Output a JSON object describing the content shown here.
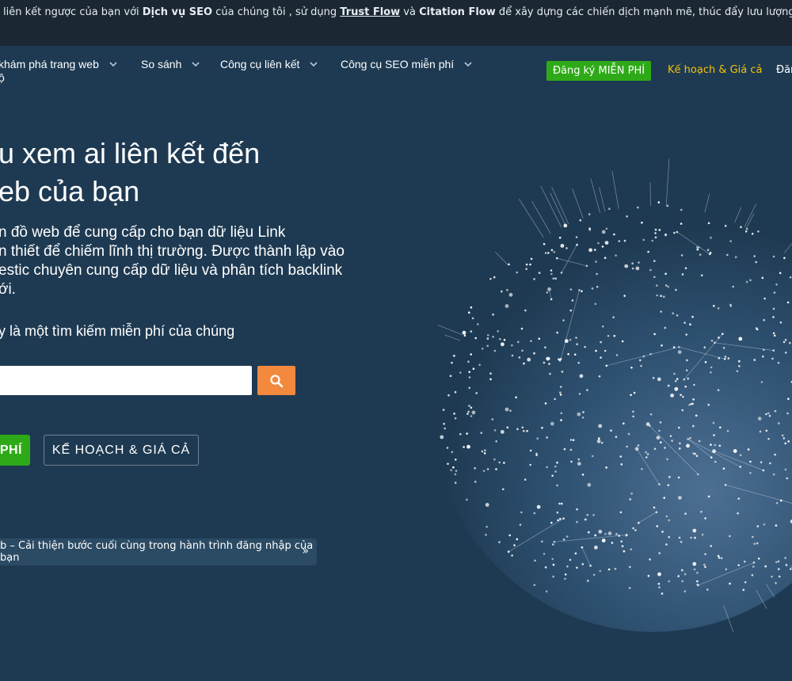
{
  "topbar": {
    "p1": " liên kết ngược của bạn với ",
    "b1": "Dịch vụ SEO",
    "p2": " của chúng tôi , sử dụng ",
    "tf": "Trust Flow",
    "p3": " và ",
    "b2": "Citation Flow",
    "p4": " để xây dựng các chiến dịch mạnh mẽ, thúc đẩy lưu lượng tru"
  },
  "nav": {
    "items": [
      {
        "label": "khám phá trang web"
      },
      {
        "label": "So sánh"
      },
      {
        "label": "Công cụ liên kết"
      },
      {
        "label": "Công cụ SEO miễn phí"
      }
    ],
    "sub_label": "ộ",
    "signup": "Đăng ký MIỄN PHÍ",
    "plans": "Kế hoạch & Giá cả",
    "login": "Đăn"
  },
  "hero": {
    "title_line1": "u xem ai liên kết đến",
    "title_line2": "eb của bạn",
    "desc_line1": "n đồ web để cung cấp cho bạn dữ liệu Link",
    "desc_line2": "n thiết để chiếm lĩnh thị trường. Được thành lập vào",
    "desc_line3": "estic chuyên cung cấp dữ liệu và phân tích backlink",
    "desc_line4": "ới.",
    "note": "y là một tìm kiếm miễn phí của chúng"
  },
  "search": {
    "value": "",
    "placeholder": ""
  },
  "cta": {
    "free": "PHÍ",
    "plans": "KẾ HOẠCH & GIÁ CẢ"
  },
  "news": {
    "text": "b – Cải thiện bước cuối cùng trong hành trình đăng nhập của bạn",
    "arrow": "»"
  },
  "colors": {
    "background": "#1e3a52",
    "topbar": "#1b2733",
    "green": "#2eaa18",
    "orange": "#f2893d",
    "gold": "#f2c200"
  }
}
